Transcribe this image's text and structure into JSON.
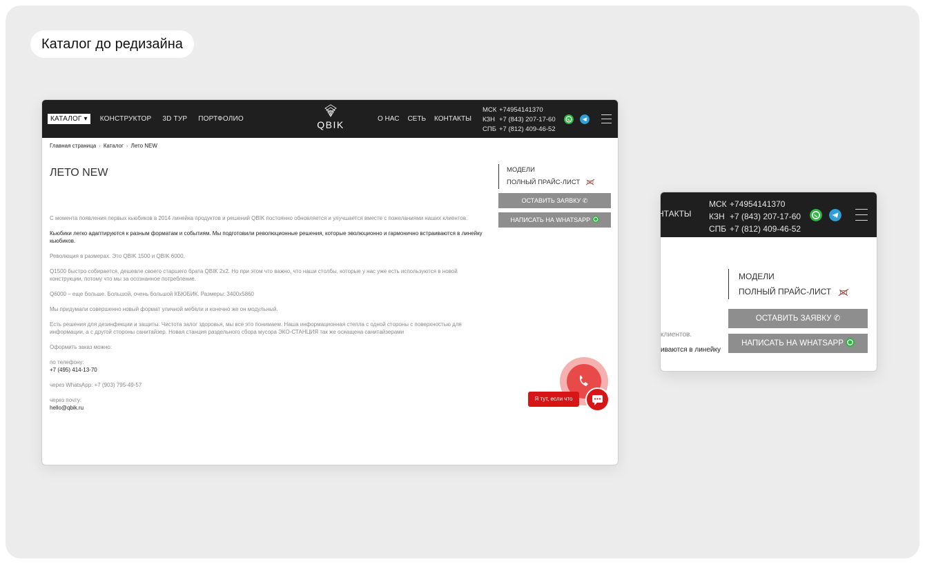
{
  "label": "Каталог до редизайна",
  "header": {
    "nav_left": [
      "КАТАЛОГ ▾",
      "КОНСТРУКТОР",
      "3D ТУР",
      "ПОРТФОЛИО"
    ],
    "logo_text": "QBIK",
    "nav_right": [
      "О НАС",
      "СЕТЬ",
      "КОНТАКТЫ"
    ],
    "phones": [
      {
        "city": "МСК",
        "number": "+74954141370"
      },
      {
        "city": "КЗН",
        "number": "+7 (843) 207-17-60"
      },
      {
        "city": "СПБ",
        "number": "+7 (812) 409-46-52"
      }
    ],
    "whatsapp_color": "#2fb543",
    "telegram_color": "#2f9fd8"
  },
  "breadcrumbs": [
    "Главная страница",
    "Каталог",
    "Лето NEW"
  ],
  "page_title": "ЛЕТО NEW",
  "paragraphs": [
    "С момента появления первых кьюбиков в 2014 линейка продуктов и решений QBIK постоянно обновляется и улучшается вместе с пожеланиями наших клиентов.",
    "Кьюбики легко адаптируются к разным форматам и событиям. Мы подготовили революционные решения, которые эволюционно и гармонично встраиваются в линейку кьюбиков.",
    "Революция в размерах. Это QBIK 1500 и QBIK 6000.",
    "Q1500 быстро собирается, дешевле своего старшего брата QBIK 2х2. Но при этом что важно, что наши столбы, которые у нас уже есть используются в новой конструкции, потому что мы за осознанное потребление.",
    "Q6000 – еще больше. Большой, очень большой КБЮБИК. Размеры: 3400х5860",
    "Мы придумали совершенно новый формат уличной мебели и конечно же он модульный.",
    "Есть решения для дезинфекции и защиты. Чистота залог здоровья, мы все это понимаем. Наша информационная стелла с одной стороны с поверхностью для информации, а с другой стороны санитайзер. Новая станция раздельного сбора мусора ЭКО-СТАНЦИЯ так же оснащена санитайзерами",
    "Оформить заказ можно:"
  ],
  "contacts": {
    "phone_label": "по телефону:",
    "phone": "+7 (495) 414-13-70",
    "whatsapp_line": "через WhatsApp: +7 (903) 795-49-57",
    "email_label": "через почту:",
    "email": "hello@qbik.ru"
  },
  "sidebar": {
    "menu": [
      "МОДЕЛИ",
      "ПОЛНЫЙ ПРАЙС-ЛИСТ"
    ],
    "btn_request": "ОСТАВИТЬ ЗАЯВКУ",
    "btn_whatsapp": "НАПИСАТЬ НА WHATSAPP"
  },
  "chat_bubble": "Я тут, если что",
  "zoom": {
    "nav_fragment": "НТАКТЫ",
    "text_fragment_1": "клиентов.",
    "text_fragment_2": "иваются в линейку"
  },
  "colors": {
    "header_bg": "#1f1f1f",
    "button_gray": "#8e8e8e",
    "accent_red": "#d61616"
  }
}
